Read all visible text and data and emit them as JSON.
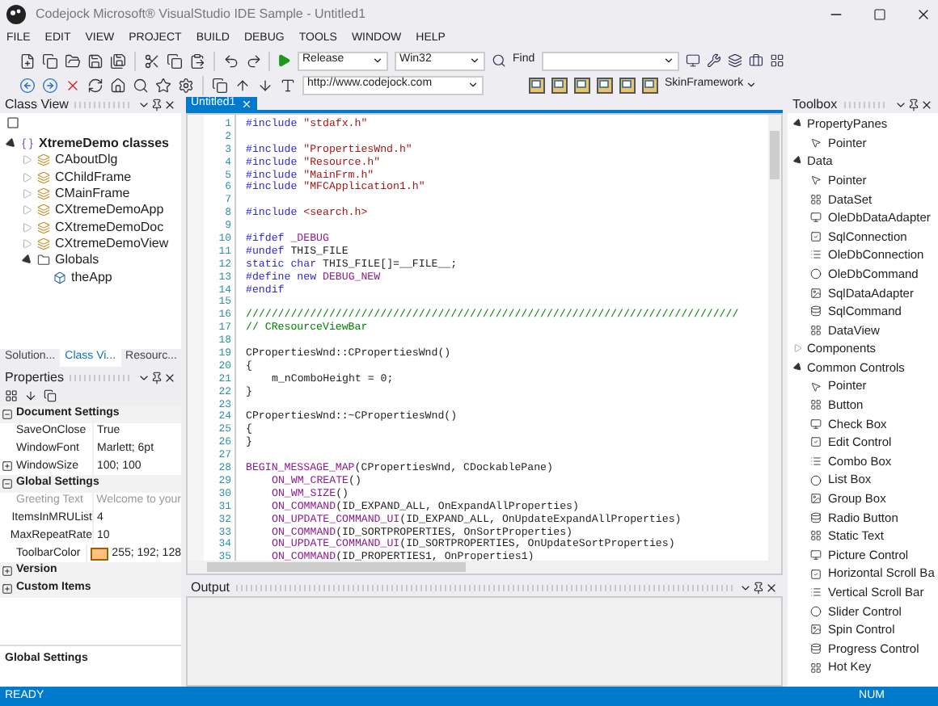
{
  "window": {
    "title": "Codejock Microsoft® VisualStudio IDE Sample - Untitled1"
  },
  "menu": [
    "FILE",
    "EDIT",
    "VIEW",
    "PROJECT",
    "BUILD",
    "DEBUG",
    "TOOLS",
    "WINDOW",
    "HELP"
  ],
  "toolbar": {
    "configuration": "Release",
    "platform": "Win32",
    "find_label": "Find",
    "url": "http://www.codejock.com",
    "skin_menu": "SkinFramework"
  },
  "class_view": {
    "title": "Class View",
    "tree": [
      {
        "label": "XtremeDemo classes",
        "kind": "namespace",
        "expanded": true,
        "children": [
          {
            "label": "CAboutDlg",
            "kind": "class",
            "expanded": false
          },
          {
            "label": "CChildFrame",
            "kind": "class",
            "expanded": false
          },
          {
            "label": "CMainFrame",
            "kind": "class",
            "expanded": false
          },
          {
            "label": "CXtremeDemoApp",
            "kind": "class",
            "expanded": false
          },
          {
            "label": "CXtremeDemoDoc",
            "kind": "class",
            "expanded": false
          },
          {
            "label": "CXtremeDemoView",
            "kind": "class",
            "expanded": false
          },
          {
            "label": "Globals",
            "kind": "folder",
            "expanded": true,
            "children": [
              {
                "label": "theApp",
                "kind": "variable"
              }
            ]
          }
        ]
      }
    ],
    "tabs": [
      {
        "label": "Solution...",
        "selected": false
      },
      {
        "label": "Class Vi...",
        "selected": true
      },
      {
        "label": "Resourc...",
        "selected": false
      }
    ]
  },
  "properties": {
    "title": "Properties",
    "rows": [
      {
        "kind": "category",
        "label": "Document Settings",
        "expanded": true
      },
      {
        "kind": "property",
        "name": "SaveOnClose",
        "value": "True",
        "disabled": false
      },
      {
        "kind": "property",
        "name": "WindowFont",
        "value": "Marlett; 6pt",
        "disabled": false
      },
      {
        "kind": "property",
        "name": "WindowSize",
        "value": "100; 100",
        "disabled": false,
        "expanded": false
      },
      {
        "kind": "category",
        "label": "Global Settings",
        "expanded": true
      },
      {
        "kind": "property",
        "name": "Greeting Text",
        "value": "Welcome to your",
        "disabled": true
      },
      {
        "kind": "property",
        "name": "ItemsInMRUList",
        "value": "4",
        "disabled": false
      },
      {
        "kind": "property",
        "name": "MaxRepeatRate",
        "value": "10",
        "disabled": false
      },
      {
        "kind": "property",
        "name": "ToolbarColor",
        "value": "255; 192; 128",
        "disabled": false,
        "color": "#ffc080"
      },
      {
        "kind": "category",
        "label": "Version",
        "expanded": false
      },
      {
        "kind": "category",
        "label": "Custom Items",
        "expanded": false
      }
    ],
    "description_title": "Global Settings"
  },
  "editor": {
    "tab": "Untitled1",
    "lines": [
      {
        "number": "1",
        "segments": [
          {
            "kind": "keyword",
            "text": "#include"
          },
          {
            "kind": "string",
            "text": " \"stdafx.h\""
          }
        ]
      },
      {
        "number": "2"
      },
      {
        "number": "3",
        "segments": [
          {
            "kind": "keyword",
            "text": "#include"
          },
          {
            "kind": "string",
            "text": " \"PropertiesWnd.h\""
          }
        ]
      },
      {
        "number": "4",
        "segments": [
          {
            "kind": "keyword",
            "text": "#include"
          },
          {
            "kind": "string",
            "text": " \"Resource.h\""
          }
        ]
      },
      {
        "number": "5",
        "segments": [
          {
            "kind": "keyword",
            "text": "#include"
          },
          {
            "kind": "string",
            "text": " \"MainFrm.h\""
          }
        ]
      },
      {
        "number": "6",
        "segments": [
          {
            "kind": "keyword",
            "text": "#include"
          },
          {
            "kind": "string",
            "text": " \"MFCApplication1.h\""
          }
        ]
      },
      {
        "number": "7"
      },
      {
        "number": "8",
        "segments": [
          {
            "kind": "keyword",
            "text": "#include"
          },
          {
            "kind": "string",
            "text": " <search.h>"
          }
        ]
      },
      {
        "number": "9"
      },
      {
        "number": "10",
        "segments": [
          {
            "kind": "keyword",
            "text": "#ifdef"
          },
          {
            "kind": "macro",
            "text": " _DEBUG"
          }
        ]
      },
      {
        "number": "11",
        "segments": [
          {
            "kind": "keyword",
            "text": "#undef"
          },
          {
            "kind": "plain",
            "text": " THIS_FILE"
          }
        ]
      },
      {
        "number": "12",
        "segments": [
          {
            "kind": "keyword",
            "text": "static"
          },
          {
            "kind": "keyword",
            "text": " char"
          },
          {
            "kind": "plain",
            "text": " THIS_FILE[]=__FILE__;"
          }
        ]
      },
      {
        "number": "13",
        "segments": [
          {
            "kind": "keyword",
            "text": "#define"
          },
          {
            "kind": "keyword",
            "text": " new"
          },
          {
            "kind": "macro",
            "text": " DEBUG_NEW"
          }
        ]
      },
      {
        "number": "14",
        "segments": [
          {
            "kind": "keyword",
            "text": "#endif"
          }
        ]
      },
      {
        "number": "15"
      },
      {
        "number": "16",
        "segments": [
          {
            "kind": "comment",
            "text": "/////////////////////////////////////////////////////////////////////////////"
          }
        ]
      },
      {
        "number": "17",
        "segments": [
          {
            "kind": "comment",
            "text": "// CResourceViewBar"
          }
        ]
      },
      {
        "number": "18"
      },
      {
        "number": "19",
        "segments": [
          {
            "kind": "plain",
            "text": "CPropertiesWnd::CPropertiesWnd()"
          }
        ]
      },
      {
        "number": "20",
        "segments": [
          {
            "kind": "plain",
            "text": "{"
          }
        ]
      },
      {
        "number": "21",
        "indent": true,
        "segments": [
          {
            "kind": "plain",
            "text": "m_nComboHeight = 0;"
          }
        ]
      },
      {
        "number": "22",
        "segments": [
          {
            "kind": "plain",
            "text": "}"
          }
        ]
      },
      {
        "number": "23"
      },
      {
        "number": "24",
        "segments": [
          {
            "kind": "plain",
            "text": "CPropertiesWnd::~CPropertiesWnd()"
          }
        ]
      },
      {
        "number": "25",
        "segments": [
          {
            "kind": "plain",
            "text": "{"
          }
        ]
      },
      {
        "number": "26",
        "segments": [
          {
            "kind": "plain",
            "text": "}"
          }
        ]
      },
      {
        "number": "27"
      },
      {
        "number": "28",
        "segments": [
          {
            "kind": "macro",
            "text": "BEGIN_MESSAGE_MAP"
          },
          {
            "kind": "plain",
            "text": "(CPropertiesWnd, CDockablePane)"
          }
        ]
      },
      {
        "number": "29",
        "indent": true,
        "segments": [
          {
            "kind": "macro",
            "text": "ON_WM_CREATE"
          },
          {
            "kind": "plain",
            "text": "()"
          }
        ]
      },
      {
        "number": "30",
        "indent": true,
        "segments": [
          {
            "kind": "macro",
            "text": "ON_WM_SIZE"
          },
          {
            "kind": "plain",
            "text": "()"
          }
        ]
      },
      {
        "number": "31",
        "indent": true,
        "segments": [
          {
            "kind": "macro",
            "text": "ON_COMMAND"
          },
          {
            "kind": "plain",
            "text": "(ID_EXPAND_ALL, OnExpandAllProperties)"
          }
        ]
      },
      {
        "number": "32",
        "indent": true,
        "segments": [
          {
            "kind": "macro",
            "text": "ON_UPDATE_COMMAND_UI"
          },
          {
            "kind": "plain",
            "text": "(ID_EXPAND_ALL, OnUpdateExpandAllProperties)"
          }
        ]
      },
      {
        "number": "33",
        "indent": true,
        "segments": [
          {
            "kind": "macro",
            "text": "ON_COMMAND"
          },
          {
            "kind": "plain",
            "text": "(ID_SORTPROPERTIES, OnSortProperties)"
          }
        ]
      },
      {
        "number": "34",
        "indent": true,
        "segments": [
          {
            "kind": "macro",
            "text": "ON_UPDATE_COMMAND_UI"
          },
          {
            "kind": "plain",
            "text": "(ID_SORTPROPERTIES, OnUpdateSortProperties)"
          }
        ]
      },
      {
        "number": "35",
        "indent": true,
        "segments": [
          {
            "kind": "macro",
            "text": "ON_COMMAND"
          },
          {
            "kind": "plain",
            "text": "(ID_PROPERTIES1, OnProperties1)"
          }
        ]
      }
    ]
  },
  "output": {
    "title": "Output"
  },
  "toolbox": {
    "title": "Toolbox",
    "sections": [
      {
        "label": "PropertyPanes",
        "expanded": true,
        "items": [
          "Pointer"
        ]
      },
      {
        "label": "Data",
        "expanded": true,
        "items": [
          "Pointer",
          "DataSet",
          "OleDbDataAdapter",
          "SqlConnection",
          "OleDbConnection",
          "OleDbCommand",
          "SqlDataAdapter",
          "SqlCommand",
          "DataView"
        ]
      },
      {
        "label": "Components",
        "expanded": false
      },
      {
        "label": "Common Controls",
        "expanded": true,
        "items": [
          "Pointer",
          "Button",
          "Check Box",
          "Edit Control",
          "Combo Box",
          "List Box",
          "Group Box",
          "Radio Button",
          "Static Text",
          "Picture Control",
          "Horizontal Scroll Ba",
          "Vertical Scroll Bar",
          "Slider Control",
          "Spin Control",
          "Progress Control",
          "Hot Key"
        ]
      }
    ]
  },
  "status_bar": {
    "left": "READY",
    "right": "NUM"
  }
}
